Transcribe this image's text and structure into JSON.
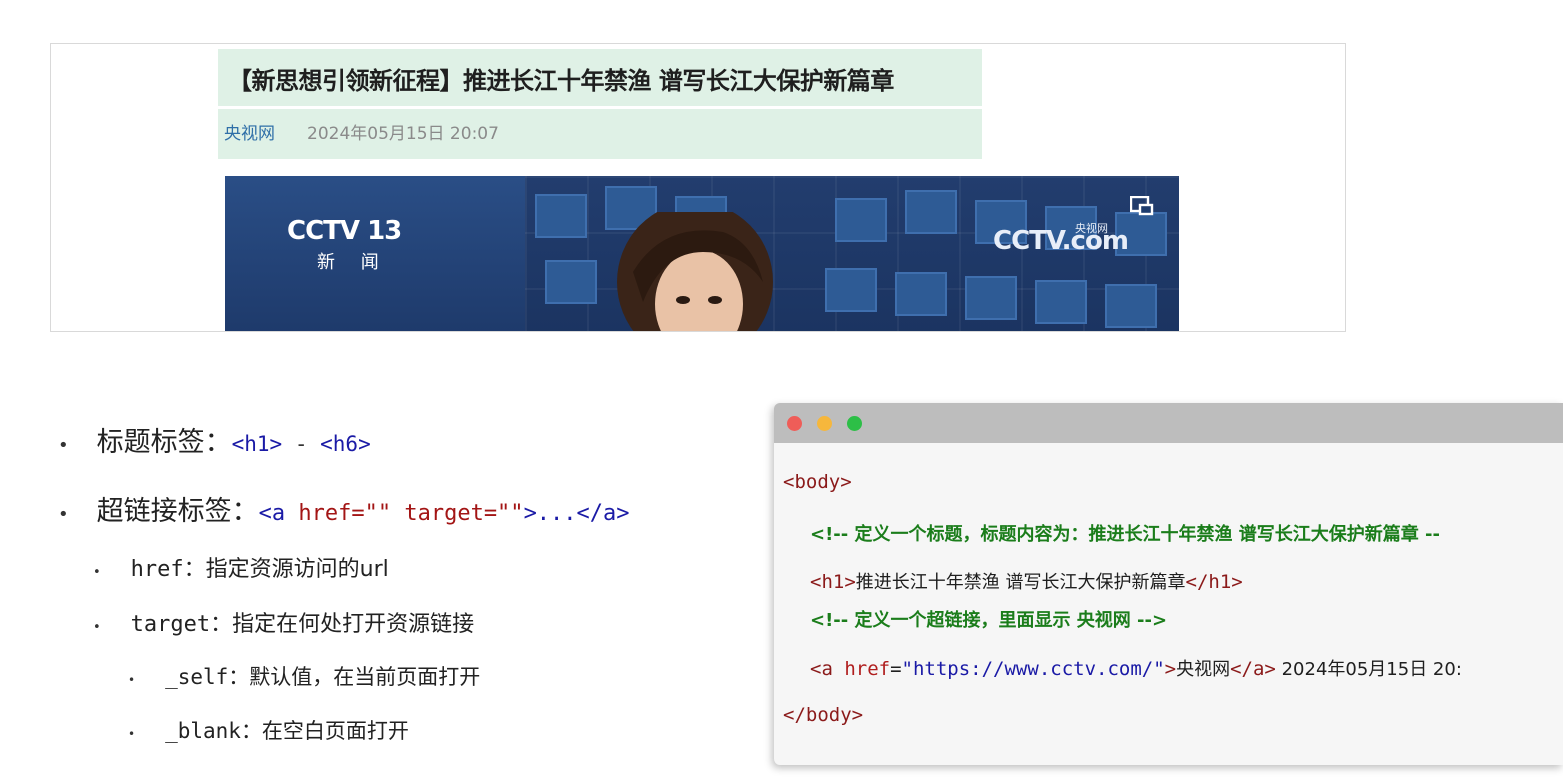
{
  "preview": {
    "title": "【新思想引领新征程】推进长江十年禁渔 谱写长江大保护新篇章",
    "source_link": "央视网",
    "date": "2024年05月15日 20:07",
    "video": {
      "channel_logo": "CCTV 13",
      "channel_sub": "新 闻",
      "watermark": "CCTV.com",
      "watermark_sub": "央视网",
      "pip_icon": "picture-in-picture-icon"
    }
  },
  "bullets": {
    "heading_tag": {
      "label": "标题标签：",
      "code_open": "<h1>",
      "sep": " - ",
      "code_close": "<h6>"
    },
    "link_tag": {
      "label": "超链接标签：",
      "code_a": "<a ",
      "code_href": "href=\"\" ",
      "code_target": "target=\"\"",
      "code_end": ">...</a>"
    },
    "href": {
      "name": "href",
      "desc": "：指定资源访问的url"
    },
    "target": {
      "name": "target",
      "desc": "：指定在何处打开资源链接"
    },
    "self": {
      "name": "_self",
      "desc": "：默认值，在当前页面打开"
    },
    "blank": {
      "name": "_blank",
      "desc": "：在空白页面打开"
    }
  },
  "code": {
    "body_open": "<body>",
    "comment1": "<!-- 定义一个标题，标题内容为：推进长江十年禁渔 谱写长江大保护新篇章 --",
    "h1_open": "<h1>",
    "h1_text": "推进长江十年禁渔 谱写长江大保护新篇章",
    "h1_close": "</h1>",
    "comment2": "<!-- 定义一个超链接，里面显示 央视网 -->",
    "a_open": "<a ",
    "a_attr": "href",
    "a_eq": "=",
    "a_val": "\"https://www.cctv.com/\"",
    "a_gt": ">",
    "a_text": "央视网",
    "a_close": "</a>",
    "a_after": " 2024年05月15日 20:",
    "body_close": "</body>"
  },
  "colors": {
    "header_bg": "#dff1e6",
    "link": "#2f6fa8",
    "code_tag": "#8b1a1a",
    "code_string": "#1a1aa6",
    "code_comment": "#1b7d1b"
  }
}
